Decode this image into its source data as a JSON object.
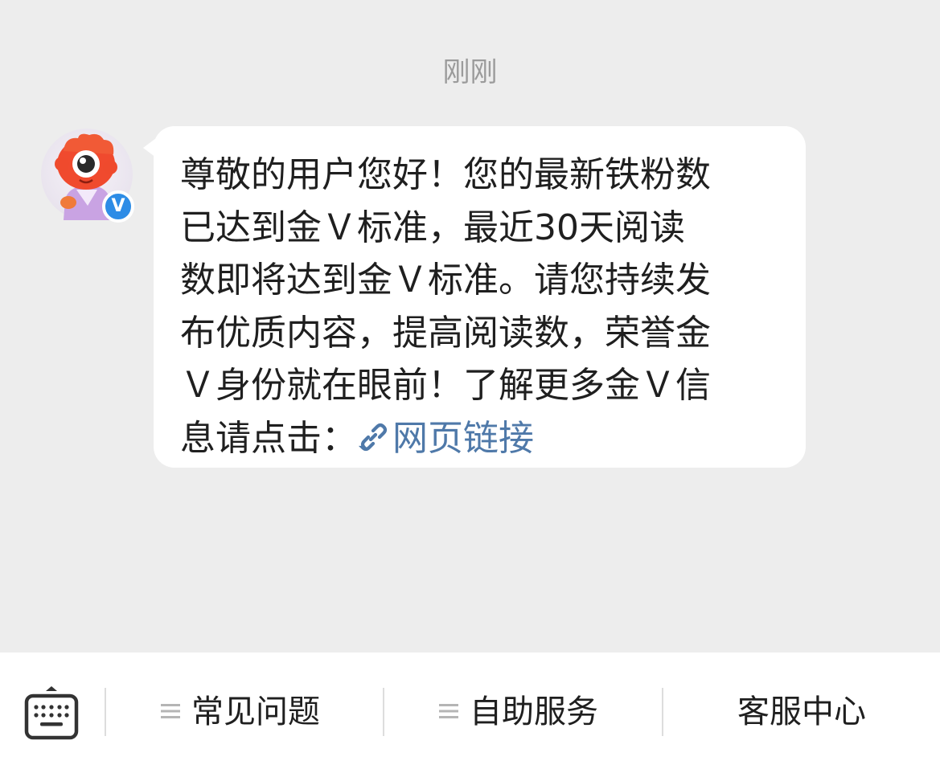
{
  "chat": {
    "timestamp": "刚刚",
    "sender": {
      "avatar_icon": "mascot-avatar-icon",
      "verified_badge": "V"
    },
    "message": {
      "lines": [
        "尊敬的用户您好！您的最新铁粉数",
        "已达到金Ｖ标准，最近30天阅读",
        "数即将达到金Ｖ标准。请您持续发",
        "布优质内容，提高阅读数，荣誉金",
        "Ｖ身份就在眼前！了解更多金Ｖ信"
      ],
      "last_line_prefix": "息请点击：",
      "link_label": "网页链接",
      "link_icon": "link-icon"
    }
  },
  "bottom_bar": {
    "keyboard_icon": "keyboard-icon",
    "menu": [
      {
        "label": "常见问题",
        "has_menu_icon": true
      },
      {
        "label": "自助服务",
        "has_menu_icon": true
      },
      {
        "label": "客服中心",
        "has_menu_icon": false
      }
    ]
  },
  "colors": {
    "chat_background": "#EDEDED",
    "bubble_background": "#FFFFFF",
    "text": "#1F1F1F",
    "timestamp": "#9B9B9B",
    "link": "#4F79A9",
    "verified_badge": "#2D8CE6"
  }
}
